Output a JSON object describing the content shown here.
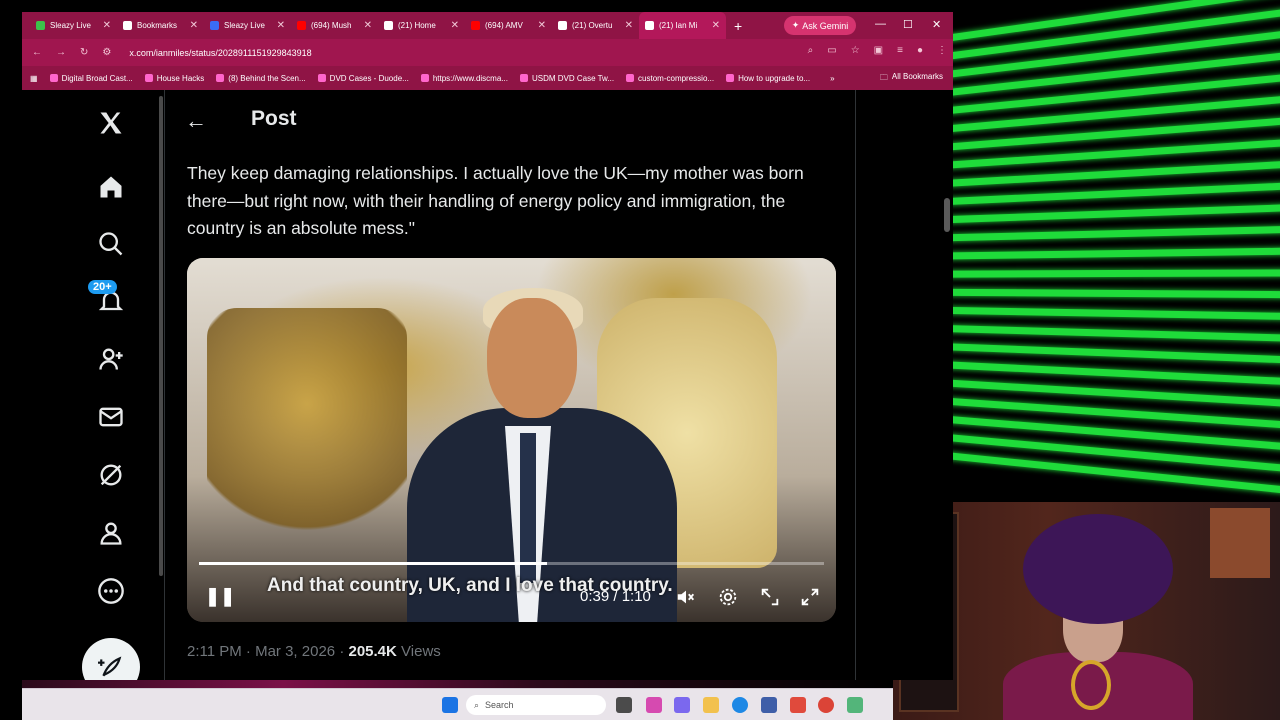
{
  "browser": {
    "tabs": [
      {
        "label": "Sleazy Live",
        "icon": "rumble-icon",
        "color": "#3cc14a",
        "active": false
      },
      {
        "label": "Bookmarks",
        "icon": "star-icon",
        "color": "#ffffff",
        "active": false
      },
      {
        "label": "Sleazy Live",
        "icon": "b-icon",
        "color": "#3b6cf5",
        "active": false
      },
      {
        "label": "(694) Mush",
        "icon": "youtube-icon",
        "color": "#ff0000",
        "active": false
      },
      {
        "label": "(21) Home",
        "icon": "x-icon",
        "color": "#ffffff",
        "active": false
      },
      {
        "label": "(694) AMV",
        "icon": "youtube-icon",
        "color": "#ff0000",
        "active": false
      },
      {
        "label": "(21) Overtu",
        "icon": "x-icon",
        "color": "#ffffff",
        "active": false
      },
      {
        "label": "(21) Ian Mi",
        "icon": "x-icon",
        "color": "#ffffff",
        "active": true
      }
    ],
    "gemini_label": "Ask Gemini",
    "url": "x.com/ianmiles/status/2028911151929843918",
    "bookmarks": [
      "Digital Broad Cast...",
      "House Hacks",
      "(8) Behind the Scen...",
      "DVD Cases - Duode...",
      "https://www.discma...",
      "USDM DVD Case Tw...",
      "custom-compressio...",
      "How to upgrade to..."
    ],
    "all_bookmarks": "All Bookmarks"
  },
  "nav": {
    "notifications_badge": "20+"
  },
  "post": {
    "header": "Post",
    "text": "They keep damaging relationships. I actually love the UK—my mother was born there—but right now, with their handling of energy policy and immigration, the country is an absolute mess.\"",
    "video": {
      "caption": "And that country, UK, and I love that country.",
      "time": "0:39 / 1:10",
      "progress": 0.557
    },
    "time": "2:11 PM",
    "date": "Mar 3, 2026",
    "views_count": "205.4K",
    "views_label": "Views"
  },
  "taskbar": {
    "search_placeholder": "Search"
  }
}
